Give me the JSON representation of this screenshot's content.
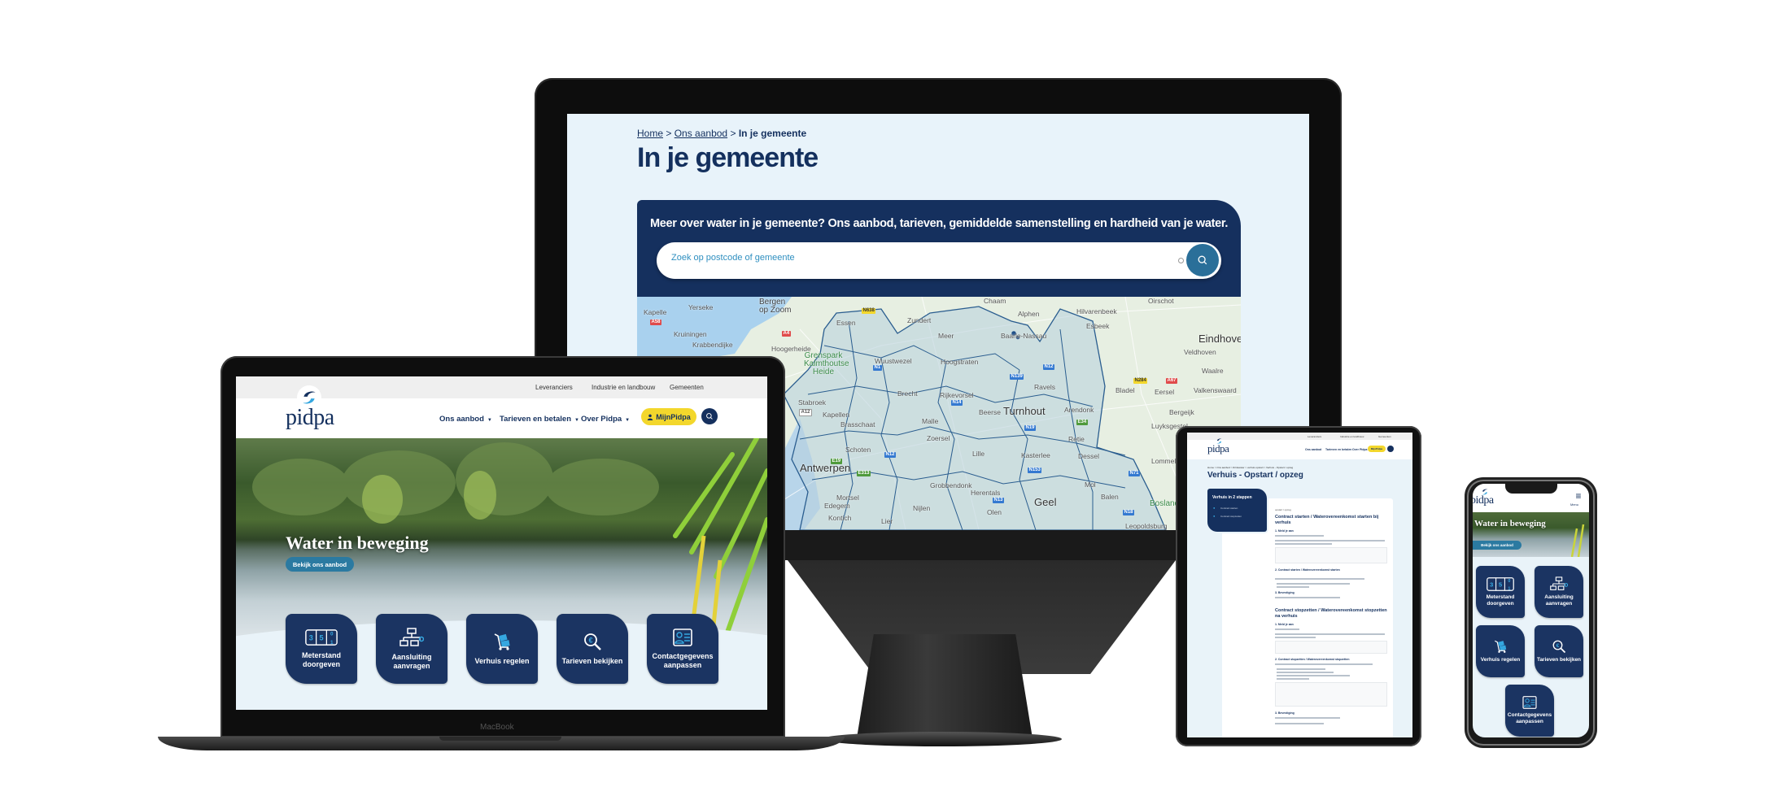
{
  "colors": {
    "navy": "#14305e",
    "accent_teal": "#2a6f99",
    "yellow": "#f3d72c",
    "page_bg": "#e9f3f9"
  },
  "monitor": {
    "breadcrumb": [
      {
        "label": "Home"
      },
      {
        "label": "Ons aanbod"
      },
      {
        "label": "In je gemeente"
      }
    ],
    "breadcrumb_separator": ">",
    "title": "In je gemeente",
    "panel_text": "Meer over water in je gemeente? Ons aanbod, tarieven, gemiddelde samenstelling en hardheid van je water.",
    "search": {
      "placeholder": "Zoek op postcode of gemeente",
      "value": "",
      "icon": "search-icon"
    },
    "map": {
      "places": [
        "Yerseke",
        "Kapelle",
        "Kruiningen",
        "Krabbendijke",
        "Bergen op Zoom",
        "Hoogerheide",
        "Essen",
        "Zundert",
        "Chaam",
        "Alphen",
        "Meer",
        "Baarle-Nassau",
        "Hilvarenbeek",
        "Esbeek",
        "Oirschot",
        "Eindhoven",
        "Veldhoven",
        "Waalre",
        "Valkenswaard",
        "Bladel",
        "Eersel",
        "Bergeijk",
        "Luyksgestel",
        "Lommel",
        "Bosland",
        "Hoogstraten",
        "Wuustwezel",
        "Ravels",
        "Brecht",
        "Rijkevorsel",
        "Turnhout",
        "Beerse",
        "Arendonk",
        "Malle",
        "Zoersel",
        "Retie",
        "Lille",
        "Kasterlee",
        "Dessel",
        "Antwerpen",
        "Schoten",
        "Brasschaat",
        "Stabroek",
        "Kapellen",
        "Grobbendonk",
        "Herentals",
        "Geel",
        "Mol",
        "Balen",
        "Nijlen",
        "Lier",
        "Mortsel",
        "Edegem",
        "Kontich",
        "Olen",
        "Grenspark Kalmthoutse Heide",
        "Leopoldsburg"
      ],
      "roads": [
        "A58",
        "A4",
        "N638",
        "N1",
        "N14",
        "N12",
        "N139",
        "N284",
        "A67",
        "E34",
        "N19",
        "N12",
        "N18",
        "N71",
        "E313",
        "N13",
        "N153",
        "E19",
        "A12"
      ]
    }
  },
  "laptop": {
    "brand": "MacBook",
    "topbar": [
      "Leveranciers",
      "Industrie en landbouw",
      "Gemeenten"
    ],
    "logo": "pidpa",
    "nav": [
      {
        "label": "Ons aanbod"
      },
      {
        "label": "Tarieven en betalen"
      },
      {
        "label": "Over Pidpa"
      }
    ],
    "account_button": "MijnPidpa",
    "hero_title": "Water in beweging",
    "hero_button": "Bekijk ons aanbod",
    "tiles": [
      {
        "label": "Meterstand doorgeven",
        "icon": "meter-icon"
      },
      {
        "label": "Aansluiting aanvragen",
        "icon": "network-icon"
      },
      {
        "label": "Verhuis regelen",
        "icon": "moving-cart-icon"
      },
      {
        "label": "Tarieven bekijken",
        "icon": "euro-search-icon"
      },
      {
        "label": "Contactgegevens aanpassen",
        "icon": "contact-card-icon"
      }
    ]
  },
  "tablet": {
    "topbar": [
      "Leveranciers",
      "Industrie en landbouw",
      "Gemeenten"
    ],
    "logo": "pidpa",
    "nav": [
      "Ons aanbod",
      "Tarieven en betalen",
      "Over Pidpa"
    ],
    "account_button": "MijnPidpa",
    "breadcrumb": "Home > Ons aanbod > Drinkwater > verhuis opstart > Verhuis - Opstart / opzeg",
    "title": "Verhuis - Opstart / opzeg",
    "steps_title": "Verhuis in 2 stappen",
    "steps": [
      "Contract starten",
      "Contract stopzetten"
    ],
    "content": {
      "tag": "opstart / opzeg",
      "h1": "Contract starten / Waterovereenkomst starten bij verhuis",
      "s1": "1. Meld je aan",
      "s2": "2. Contract starten / Waterovereenkomst starten",
      "s3": "3. Bevestiging",
      "h2": "Contract stopzetten / Waterovereenkomst stopzetten na verhuis",
      "s4": "1. Meld je aan",
      "s5": "2. Contract stopzetten / Waterovereenkomst stopzetten",
      "s6": "3. Bevestiging"
    }
  },
  "phone": {
    "logo": "pidpa",
    "menu_label": "Menu",
    "hero_title": "Water in beweging",
    "hero_button": "Bekijk ons aanbod",
    "tiles": [
      {
        "label": "Meterstand doorgeven",
        "icon": "meter-icon"
      },
      {
        "label": "Aansluiting aanvragen",
        "icon": "network-icon"
      },
      {
        "label": "Verhuis regelen",
        "icon": "moving-cart-icon"
      },
      {
        "label": "Tarieven bekijken",
        "icon": "euro-search-icon"
      },
      {
        "label": "Contactgegevens aanpassen",
        "icon": "contact-card-icon"
      }
    ]
  }
}
